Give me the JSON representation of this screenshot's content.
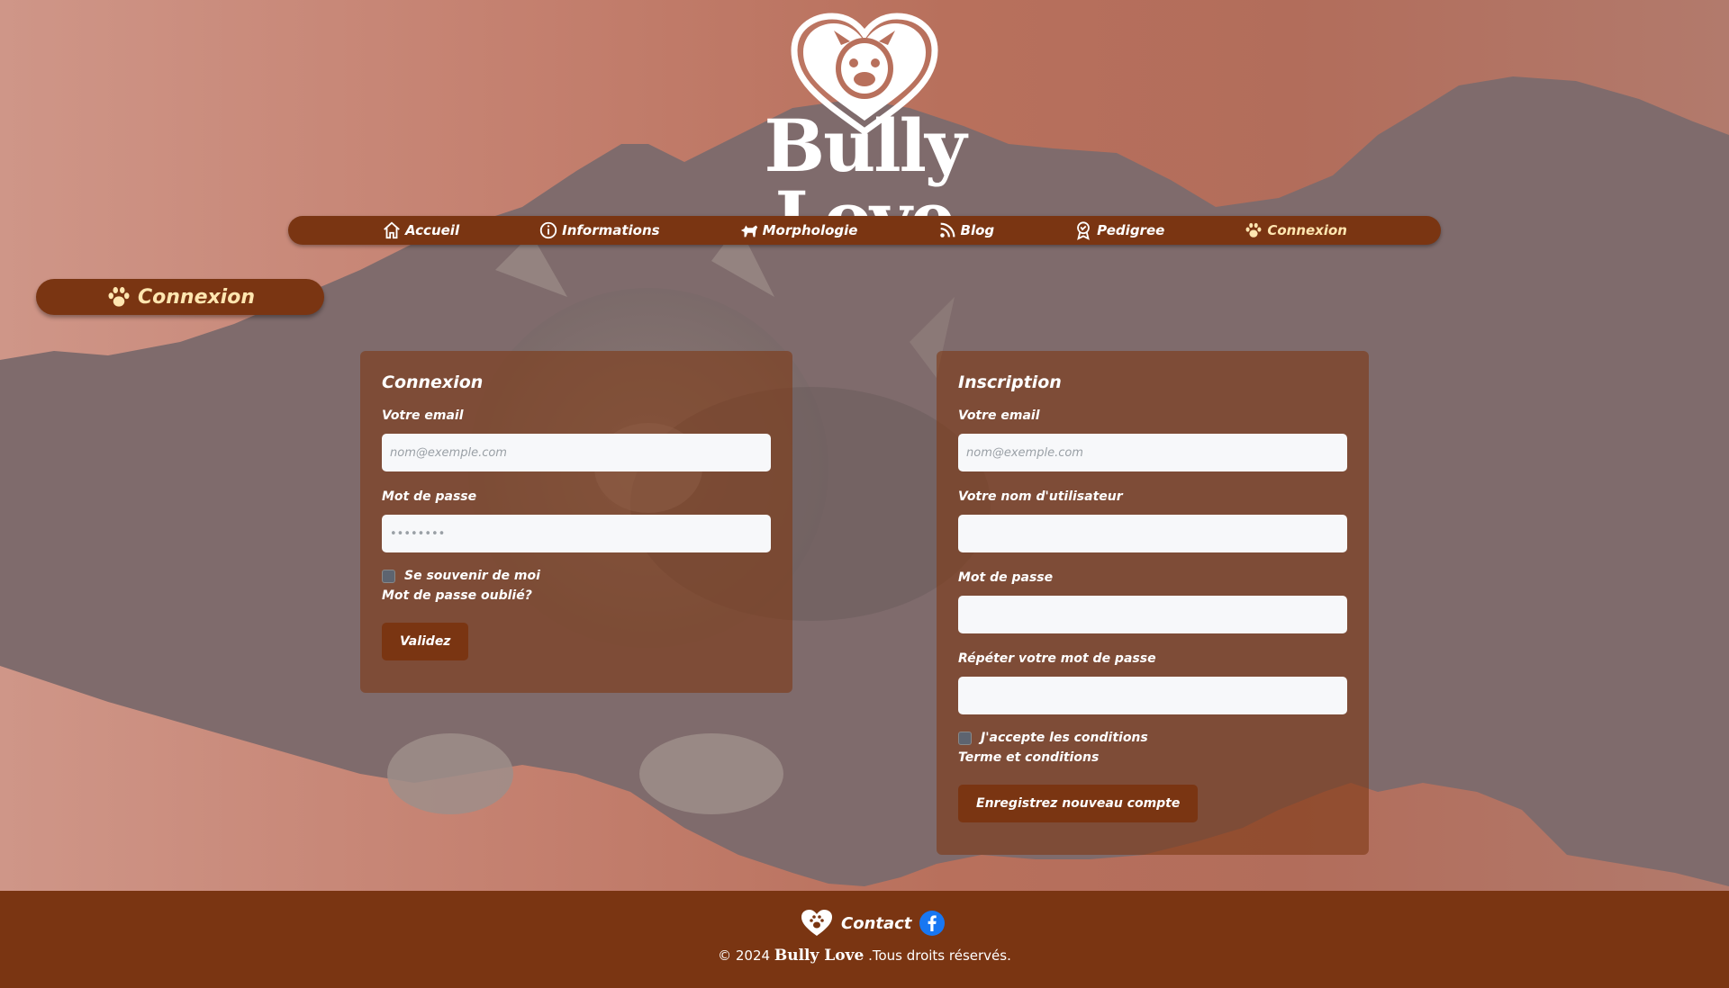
{
  "brand": {
    "name": "Bully Love",
    "logo_icon": "bulldog-heart-logo"
  },
  "nav": {
    "items": [
      {
        "label": "Accueil",
        "icon": "home-icon"
      },
      {
        "label": "Informations",
        "icon": "info-icon"
      },
      {
        "label": "Morphologie",
        "icon": "dog-icon"
      },
      {
        "label": "Blog",
        "icon": "rss-icon"
      },
      {
        "label": "Pedigree",
        "icon": "award-icon"
      },
      {
        "label": "Connexion",
        "icon": "paw-icon",
        "active": true
      }
    ]
  },
  "page_title": "Connexion",
  "login": {
    "title": "Connexion",
    "email_label": "Votre email",
    "email_placeholder": "nom@exemple.com",
    "password_label": "Mot de passe",
    "password_placeholder": "••••••••",
    "remember_label": "Se souvenir de moi",
    "forgot_label": "Mot de passe oublié?",
    "submit_label": "Validez"
  },
  "register": {
    "title": "Inscription",
    "email_label": "Votre email",
    "email_placeholder": "nom@exemple.com",
    "username_label": "Votre nom d'utilisateur",
    "password_label": "Mot de passe",
    "repeat_password_label": "Répéter votre mot de passe",
    "accept_label": "J'accepte les conditions",
    "terms_label": "Terme et conditions",
    "submit_label": "Enregistrez nouveau compte"
  },
  "footer": {
    "contact_label": "Contact",
    "copyright_prefix": "© 2024",
    "copyright_brand": "Bully Love",
    "copyright_suffix": ".Tous droits réservés."
  },
  "colors": {
    "primary_brown": "#7a3512",
    "accent_cream": "#ffe6b0",
    "facebook_blue": "#1877f2"
  }
}
